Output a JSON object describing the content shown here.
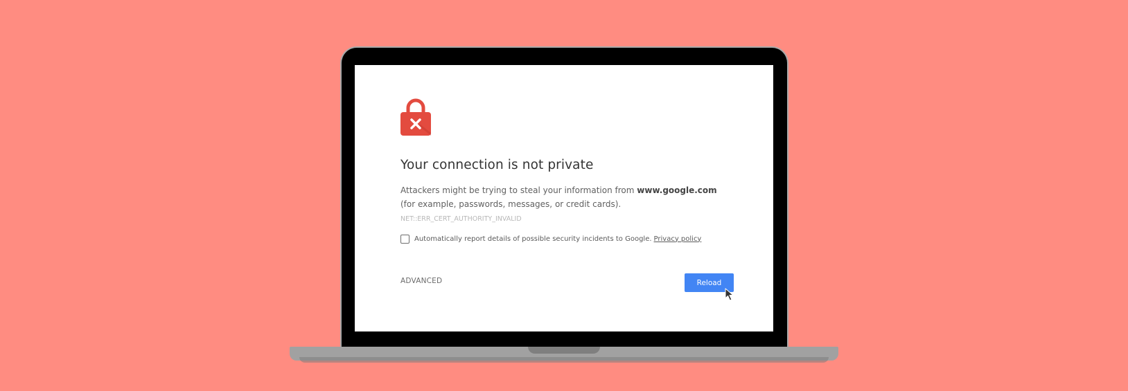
{
  "error_page": {
    "title": "Your connection is not private",
    "message_part1": "Attackers might be trying to steal your information from ",
    "domain": "www.google.com",
    "message_part2": " (for example, passwords, messages, or credit cards). ",
    "error_code": "NET::ERR_CERT_AUTHORITY_INVALID",
    "report_text": "Automatically report details of possible security incidents to Google.",
    "report_checked": false,
    "privacy_link": "Privacy policy",
    "advanced_label": "ADVANCED",
    "reload_label": "Reload"
  },
  "icons": {
    "lock": "lock-x-icon",
    "cursor": "mouse-pointer-icon"
  },
  "colors": {
    "background": "#ff8c81",
    "lock": "#e34b3f",
    "reload_button": "#4285f4"
  }
}
